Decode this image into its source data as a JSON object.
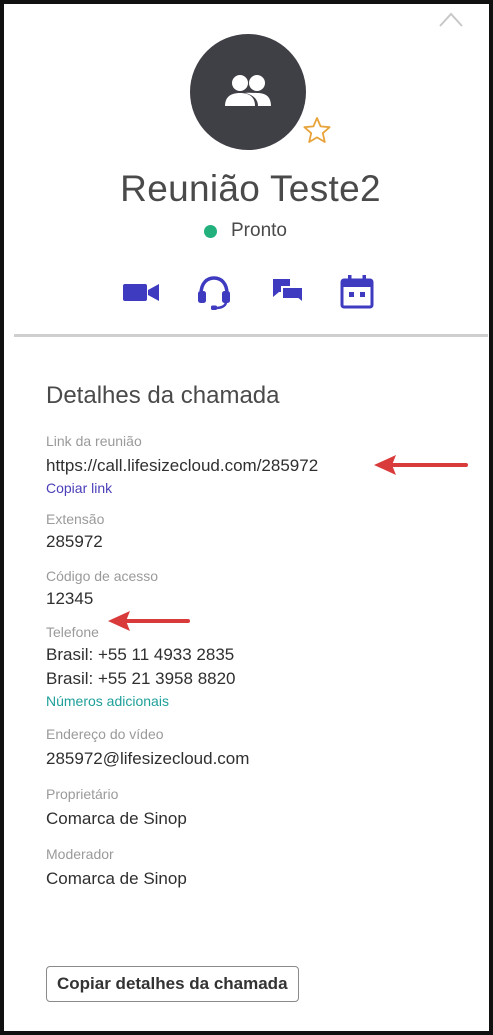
{
  "meeting": {
    "title": "Reunião Teste2",
    "status": "Pronto",
    "status_color": "#22b07d"
  },
  "icons": {
    "avatar": "group-icon",
    "favorite": "star-icon",
    "actions": [
      "video-icon",
      "headset-icon",
      "chat-icon",
      "calendar-icon"
    ],
    "accent": "#3f3bc1"
  },
  "details": {
    "heading": "Detalhes da chamada",
    "link_label": "Link da reunião",
    "link_value": "https://call.lifesizecloud.com/285972",
    "copy_link": "Copiar link",
    "extension_label": "Extensão",
    "extension_value": "285972",
    "access_code_label": "Código de acesso",
    "access_code_value": "12345",
    "phone_label": "Telefone",
    "phones": [
      "Brasil: +55 11 4933 2835",
      "Brasil: +55 21 3958 8820"
    ],
    "more_numbers": "Números adicionais",
    "video_address_label": "Endereço do vídeo",
    "video_address_value": "285972@lifesizecloud.com",
    "owner_label": "Proprietário",
    "owner_value": "Comarca de Sinop",
    "moderator_label": "Moderador",
    "moderator_value": "Comarca de Sinop",
    "copy_details_button": "Copiar detalhes da chamada"
  }
}
